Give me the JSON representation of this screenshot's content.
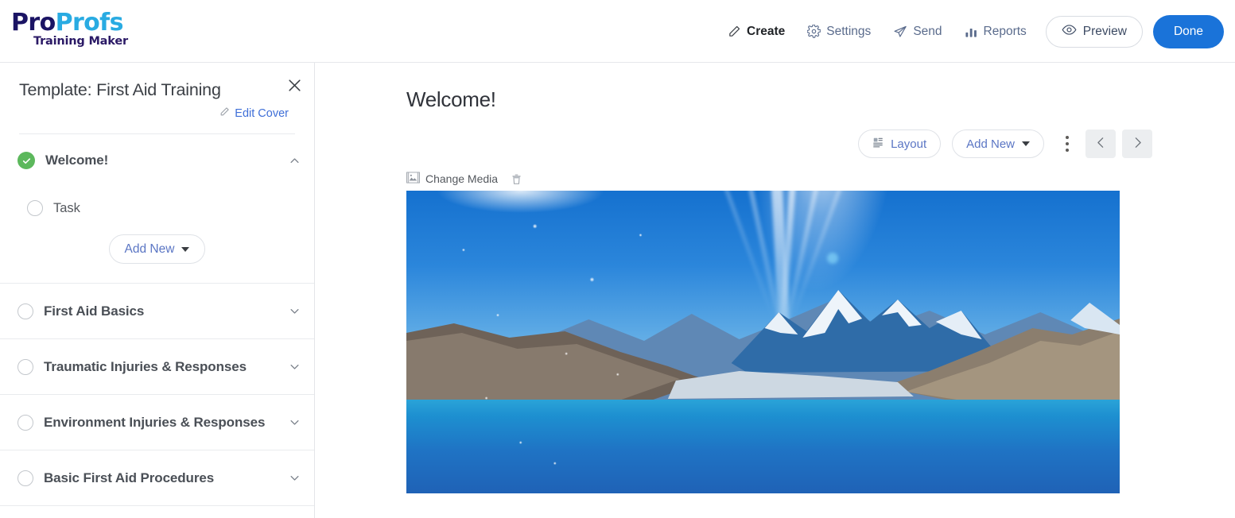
{
  "brand": {
    "name_part1": "Pro",
    "name_part2": "Profs",
    "product": "Training Maker",
    "color_primary": "#1b1464",
    "color_secondary": "#29abe2"
  },
  "topnav": {
    "items": [
      {
        "label": "Create",
        "icon": "pencil-icon",
        "active": true
      },
      {
        "label": "Settings",
        "icon": "gear-icon",
        "active": false
      },
      {
        "label": "Send",
        "icon": "paper-plane-icon",
        "active": false
      },
      {
        "label": "Reports",
        "icon": "bar-chart-icon",
        "active": false
      }
    ],
    "preview_label": "Preview",
    "preview_icon": "eye-icon",
    "done_label": "Done",
    "done_color": "#1a73d9"
  },
  "sidebar": {
    "title": "Template: First Aid Training",
    "close_icon": "close-icon",
    "edit_cover_label": "Edit Cover",
    "edit_cover_icon": "pencil-icon",
    "sections": [
      {
        "label": "Welcome!",
        "status": "complete",
        "status_icon": "check-circle-icon",
        "expanded": true,
        "chevron": "chevron-up-icon"
      },
      {
        "label": "First Aid Basics",
        "status": "incomplete",
        "status_icon": "empty-circle-icon",
        "expanded": false,
        "chevron": "chevron-down-icon"
      },
      {
        "label": "Traumatic Injuries & Responses",
        "status": "incomplete",
        "status_icon": "empty-circle-icon",
        "expanded": false,
        "chevron": "chevron-down-icon"
      },
      {
        "label": "Environment Injuries & Responses",
        "status": "incomplete",
        "status_icon": "empty-circle-icon",
        "expanded": false,
        "chevron": "chevron-down-icon"
      },
      {
        "label": "Basic First Aid Procedures",
        "status": "incomplete",
        "status_icon": "empty-circle-icon",
        "expanded": false,
        "chevron": "chevron-down-icon"
      }
    ],
    "task": {
      "label": "Task",
      "status_icon": "empty-circle-icon"
    },
    "add_new_label": "Add New"
  },
  "main": {
    "page_title": "Welcome!",
    "toolbar": {
      "layout_label": "Layout",
      "layout_icon": "layout-icon",
      "add_new_label": "Add New",
      "kebab_icon": "more-vertical-icon",
      "prev_icon": "chevron-left-icon",
      "next_icon": "chevron-right-icon"
    },
    "media": {
      "change_label": "Change Media",
      "change_icon": "image-icon",
      "delete_icon": "trash-icon",
      "cover_alt": "Snow-capped mountain range above a turquoise glacial lake under a sunlit blue sky"
    }
  }
}
